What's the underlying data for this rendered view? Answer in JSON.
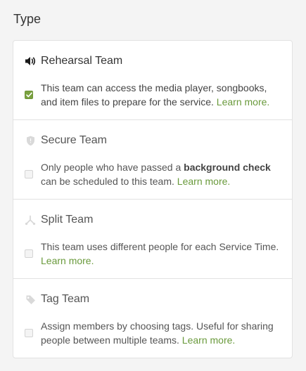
{
  "section": {
    "title": "Type"
  },
  "options": [
    {
      "title": "Rehearsal Team",
      "icon": "speaker-icon",
      "checked": true,
      "desc": "This team can access the media player, songbooks, and item files to prepare for the service.",
      "link": "Learn more."
    },
    {
      "title": "Secure Team",
      "icon": "shield-icon",
      "checked": false,
      "desc_pre": "Only people who have passed a",
      "desc_bold": "background check",
      "desc_post": "can be scheduled to this team.",
      "link": "Learn more."
    },
    {
      "title": "Split Team",
      "icon": "split-icon",
      "checked": false,
      "desc": "This team uses different people for each Service Time.",
      "link": "Learn more."
    },
    {
      "title": "Tag Team",
      "icon": "tag-icon",
      "checked": false,
      "desc": "Assign members by choosing tags. Useful for sharing people between multiple teams.",
      "link": "Learn more."
    }
  ],
  "colors": {
    "accent": "#6a9a3c",
    "checkbox_checked": "#7aa13f"
  }
}
